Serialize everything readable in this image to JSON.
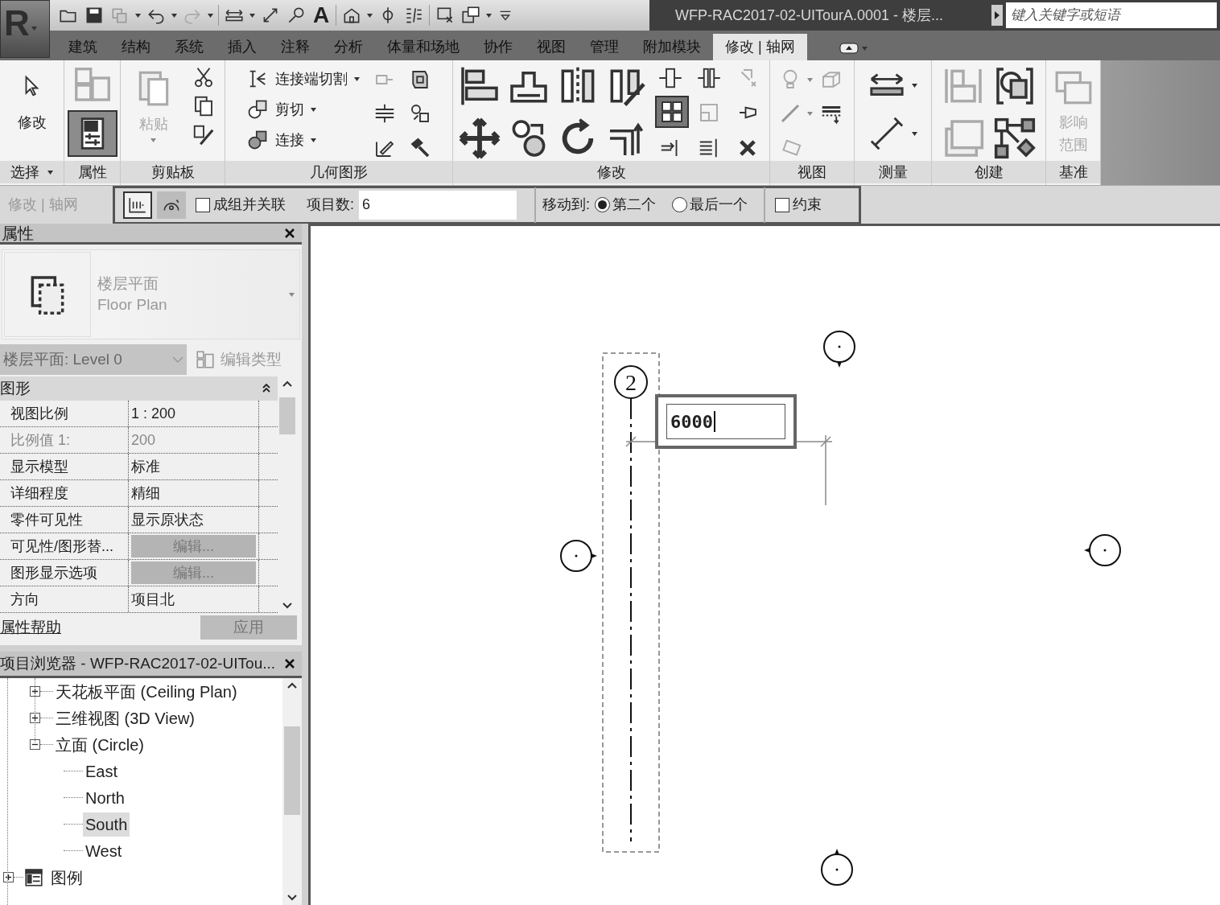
{
  "app_button": {
    "label": "R"
  },
  "quick_access": {
    "text_tool_label": "A"
  },
  "title": "WFP-RAC2017-02-UITourA.0001 - 楼层...",
  "search": {
    "placeholder": "键入关键字或短语"
  },
  "tabs": [
    {
      "label": "建筑",
      "selected": false
    },
    {
      "label": "结构",
      "selected": false
    },
    {
      "label": "系统",
      "selected": false
    },
    {
      "label": "插入",
      "selected": false
    },
    {
      "label": "注释",
      "selected": false
    },
    {
      "label": "分析",
      "selected": false
    },
    {
      "label": "体量和场地",
      "selected": false
    },
    {
      "label": "协作",
      "selected": false
    },
    {
      "label": "视图",
      "selected": false
    },
    {
      "label": "管理",
      "selected": false
    },
    {
      "label": "附加模块",
      "selected": false
    },
    {
      "label": "修改 | 轴网",
      "selected": true
    }
  ],
  "ribbon_panels": [
    {
      "title": "选择",
      "dropdown": true
    },
    {
      "title": "属性",
      "dropdown": false
    },
    {
      "title": "剪贴板",
      "dropdown": false
    },
    {
      "title": "几何图形",
      "dropdown": false
    },
    {
      "title": "修改",
      "dropdown": false
    },
    {
      "title": "视图",
      "dropdown": false
    },
    {
      "title": "测量",
      "dropdown": false
    },
    {
      "title": "创建",
      "dropdown": false
    },
    {
      "title": "基准",
      "dropdown": false
    }
  ],
  "ribbon_tools": {
    "modify": {
      "label": "修改"
    },
    "properties": {
      "selected": true
    },
    "paste": {
      "label": "粘贴",
      "disabled": true
    },
    "cope": {
      "label": "连接端切割"
    },
    "cut": {
      "label": "剪切"
    },
    "join": {
      "label": "连接"
    },
    "array": {
      "selected": true
    },
    "scope_box": {
      "label_lines": [
        "影响",
        "范围"
      ],
      "disabled": true
    }
  },
  "options_bar": {
    "context": "修改 | 轴网",
    "array_modes": [
      {
        "selected": true
      },
      {
        "selected": false
      }
    ],
    "group_and_associate": {
      "label": "成组并关联",
      "checked": false
    },
    "count": {
      "label": "项目数:",
      "value": "6"
    },
    "move_to": {
      "label": "移动到:",
      "options": [
        {
          "label": "第二个",
          "selected": true
        },
        {
          "label": "最后一个",
          "selected": false
        }
      ]
    },
    "constrain": {
      "label": "约束",
      "checked": false
    }
  },
  "properties": {
    "title": "属性",
    "type_line1": "楼层平面",
    "type_line2": "Floor Plan",
    "instance_selector": "楼层平面: Level 0",
    "edit_type": "编辑类型",
    "group": {
      "title": "图形",
      "expanded": true
    },
    "rows": [
      {
        "name": "视图比例",
        "value": "1 : 200",
        "kind": "text",
        "disabled": false
      },
      {
        "name": "比例值 1:",
        "value": "200",
        "kind": "text",
        "disabled": true
      },
      {
        "name": "显示模型",
        "value": "标准",
        "kind": "text",
        "disabled": false
      },
      {
        "name": "详细程度",
        "value": "精细",
        "kind": "text",
        "disabled": false
      },
      {
        "name": "零件可见性",
        "value": "显示原状态",
        "kind": "text",
        "disabled": false
      },
      {
        "name": "可见性/图形替...",
        "value": "编辑...",
        "kind": "button",
        "disabled": false
      },
      {
        "name": "图形显示选项",
        "value": "编辑...",
        "kind": "button",
        "disabled": false
      },
      {
        "name": "方向",
        "value": "项目北",
        "kind": "text",
        "disabled": false
      }
    ],
    "help": "属性帮助",
    "apply": "应用"
  },
  "browser": {
    "title": "项目浏览器 - WFP-RAC2017-02-UITou...",
    "items": [
      {
        "label": "天花板平面 (Ceiling Plan)",
        "expanded": false
      },
      {
        "label": "三维视图 (3D View)",
        "expanded": false
      },
      {
        "label": "立面 (Circle)",
        "expanded": true,
        "children": [
          {
            "label": "East",
            "selected": false
          },
          {
            "label": "North",
            "selected": false
          },
          {
            "label": "South",
            "selected": true
          },
          {
            "label": "West",
            "selected": false
          }
        ]
      }
    ],
    "legends": {
      "label": "图例",
      "expanded": false
    }
  },
  "canvas": {
    "grid_bubble": "2",
    "dimension_value": "6000"
  }
}
